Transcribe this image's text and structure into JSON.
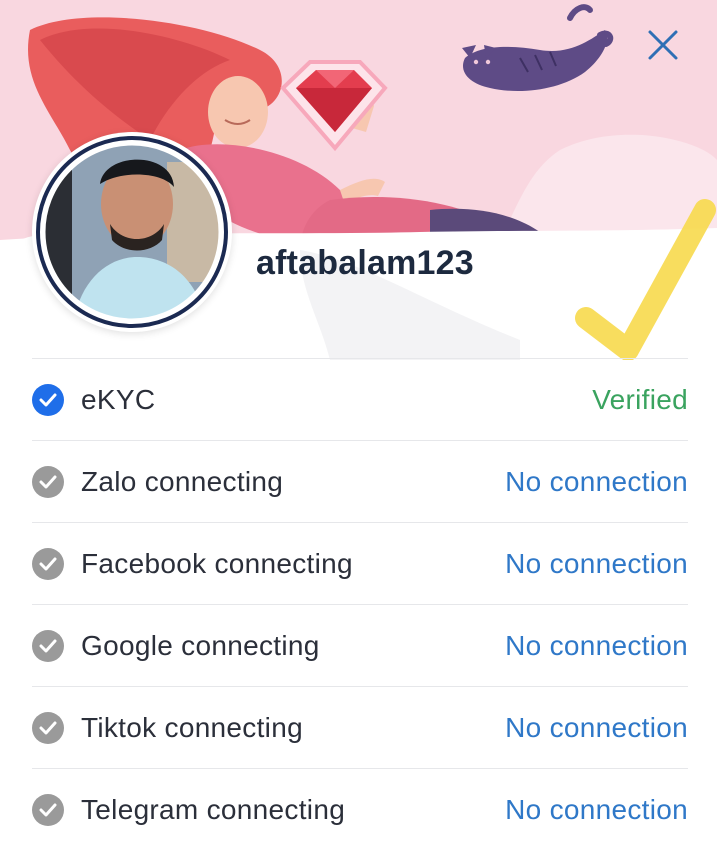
{
  "profile": {
    "username": "aftabalam123"
  },
  "connections": [
    {
      "label": "eKYC",
      "status": "Verified",
      "verified": true
    },
    {
      "label": "Zalo connecting",
      "status": "No connection",
      "verified": false
    },
    {
      "label": "Facebook connecting",
      "status": "No connection",
      "verified": false
    },
    {
      "label": "Google connecting",
      "status": "No connection",
      "verified": false
    },
    {
      "label": "Tiktok connecting",
      "status": "No connection",
      "verified": false
    },
    {
      "label": "Telegram connecting",
      "status": "No connection",
      "verified": false
    }
  ],
  "icons": {
    "close": "close-icon",
    "check": "check-circle-icon",
    "gem": "gem-icon",
    "cat": "cat-illustration",
    "checkmark": "yellow-checkmark"
  },
  "colors": {
    "verified": "#3aa35f",
    "no_connection": "#2f78c8",
    "check_on": "#1f6ee9",
    "check_off": "#9a9a9a",
    "banner_bg": "#f9d7e0"
  }
}
